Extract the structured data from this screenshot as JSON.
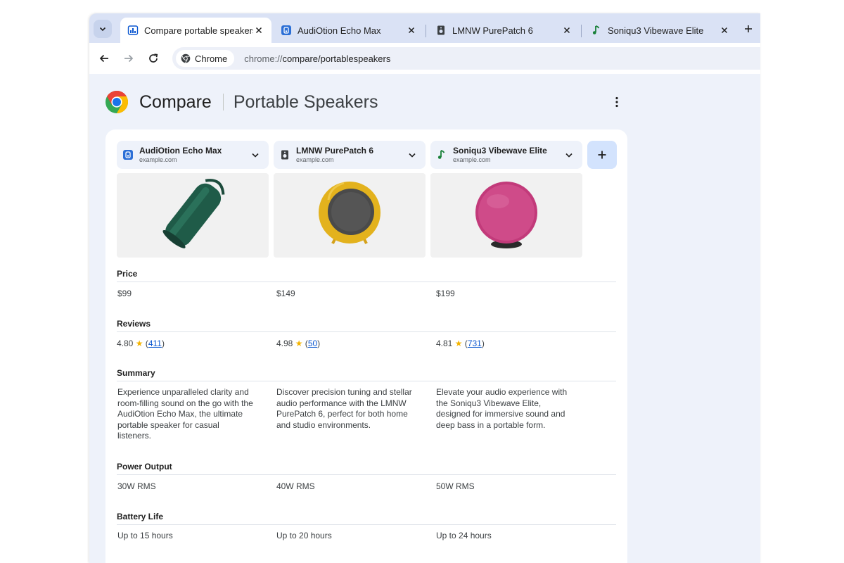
{
  "tabs": [
    {
      "title": "Compare portable speakers",
      "icon": "compare-icon",
      "active": true
    },
    {
      "title": "AudiOtion Echo Max",
      "icon": "blue-app-icon"
    },
    {
      "title": "LMNW PurePatch 6",
      "icon": "speaker-icon"
    },
    {
      "title": "Soniqu3 Vibewave Elite",
      "icon": "music-note-icon"
    }
  ],
  "toolbar": {
    "chip_label": "Chrome",
    "url_prefix": "chrome://",
    "url_path": "compare/portablespeakers"
  },
  "header": {
    "title": "Compare",
    "subtitle": "Portable Speakers"
  },
  "products": [
    {
      "name": "AudiOtion Echo Max",
      "domain": "example.com",
      "icon": "blue-app-icon",
      "price": "$99",
      "rating": "4.80",
      "review_count": "411",
      "summary": "Experience unparalleled clarity and room-filling sound on the go with the AudiOtion Echo Max, the ultimate portable speaker for casual listeners.",
      "power_output": "30W RMS",
      "battery_life": "Up to 15 hours",
      "color": "#1f5b48"
    },
    {
      "name": "LMNW PurePatch 6",
      "domain": "example.com",
      "icon": "speaker-icon",
      "price": "$149",
      "rating": "4.98",
      "review_count": "50",
      "summary": "Discover precision tuning and stellar audio performance with the LMNW PurePatch 6, perfect for both home and studio environments.",
      "power_output": "40W RMS",
      "battery_life": "Up to 20 hours",
      "color": "#e3b21d"
    },
    {
      "name": "Soniqu3 Vibewave Elite",
      "domain": "example.com",
      "icon": "music-note-icon",
      "price": "$199",
      "rating": "4.81",
      "review_count": "731",
      "summary": "Elevate your audio experience with the Soniqu3 Vibewave Elite, designed for immersive sound and deep bass in a portable form.",
      "power_output": "50W RMS",
      "battery_life": "Up to 24 hours",
      "color": "#c23a7a"
    }
  ],
  "rows": {
    "price": "Price",
    "reviews": "Reviews",
    "summary": "Summary",
    "power_output": "Power Output",
    "battery_life": "Battery Life"
  },
  "colors": {
    "tabstrip": "#dae2f5",
    "content_bg": "#eef2fa",
    "accent": "#0b57d0",
    "add_button": "#d3e3fd",
    "star": "#f4b400"
  }
}
